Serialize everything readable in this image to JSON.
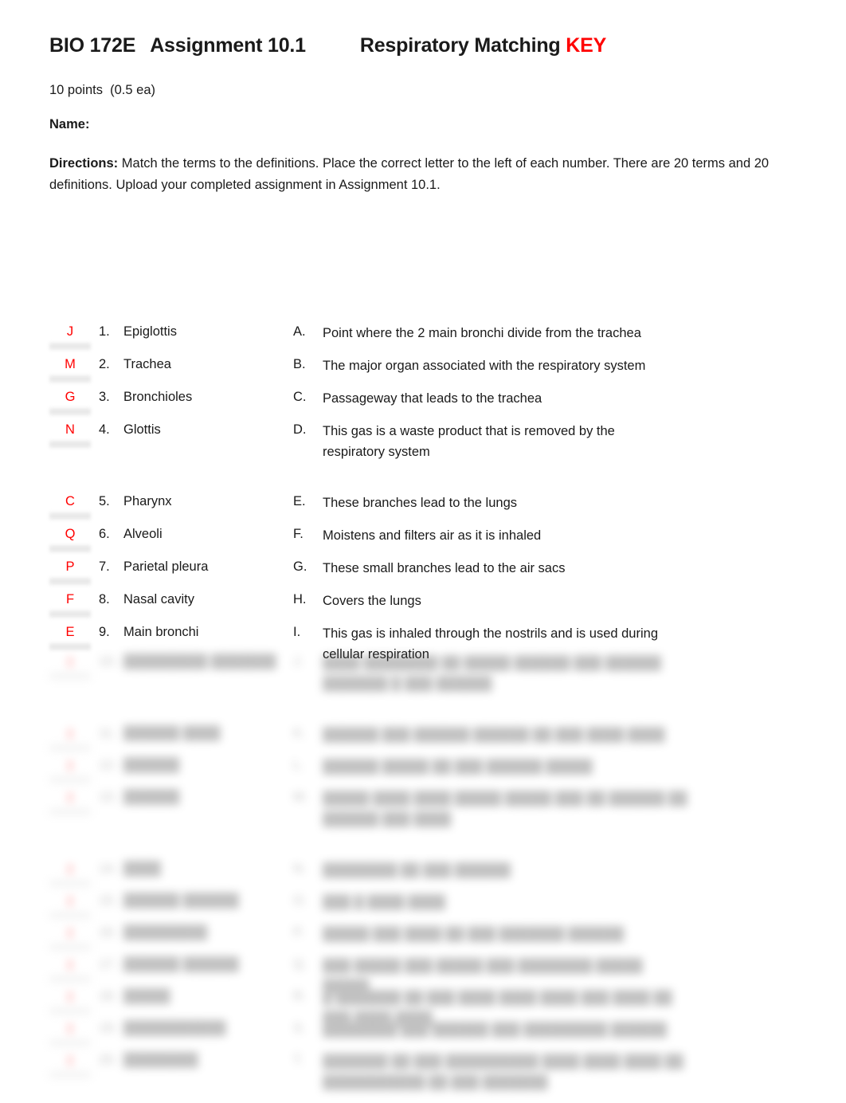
{
  "document": {
    "course": "BIO 172E",
    "assignment": "Assignment 10.1",
    "title": "Respiratory Matching",
    "key_flag": "KEY",
    "points": "10 points  (0.5 ea)",
    "name_label": "Name:",
    "directions_label": "Directions:",
    "directions_text": " Match the terms to the definitions. Place the correct letter to the left of each number. There are 20 terms and 20 definitions.  Upload your completed assignment in Assignment 10.1."
  },
  "colors": {
    "key_red": "#ff0000",
    "answer_red": "#ff0000",
    "body_text": "#1a1a1a",
    "blank_gray": "#e8e8e8",
    "page_background": "#ffffff"
  },
  "visible_terms": [
    {
      "answer": "J",
      "number": "1.",
      "term": "Epiglottis"
    },
    {
      "answer": "M",
      "number": "2.",
      "term": "Trachea"
    },
    {
      "answer": "G",
      "number": "3.",
      "term": "Bronchioles"
    },
    {
      "answer": "N",
      "number": "4.",
      "term": "Glottis"
    },
    {
      "answer": "C",
      "number": "5.",
      "term": "Pharynx"
    },
    {
      "answer": "Q",
      "number": "6.",
      "term": "Alveoli"
    },
    {
      "answer": "P",
      "number": "7.",
      "term": "Parietal pleura"
    },
    {
      "answer": "F",
      "number": "8.",
      "term": "Nasal cavity"
    },
    {
      "answer": "E",
      "number": "9.",
      "term": "Main bronchi"
    }
  ],
  "visible_definitions": [
    {
      "letter": "A.",
      "text": "Point where the 2 main bronchi divide from the trachea"
    },
    {
      "letter": "B.",
      "text": "The major organ associated with the respiratory system"
    },
    {
      "letter": "C.",
      "text": "Passageway that leads to the trachea"
    },
    {
      "letter": "D.",
      "text": "This gas is a waste product that is removed by the respiratory system"
    },
    {
      "letter": "E.",
      "text": "These branches lead to the lungs"
    },
    {
      "letter": "F.",
      "text": "Moistens and filters air as it is inhaled"
    },
    {
      "letter": "G.",
      "text": "These small branches lead to the air sacs"
    },
    {
      "letter": "H.",
      "text": "Covers the lungs"
    },
    {
      "letter": "I.",
      "text": "This gas is inhaled through the nostrils and is used during cellular respiration"
    }
  ],
  "obscured_terms": [
    {
      "answer": "▮",
      "number": "10.",
      "term": "█████████ ███████"
    },
    {
      "answer": "▮",
      "number": "11.",
      "term": "██████ ████"
    },
    {
      "answer": "▮",
      "number": "12.",
      "term": "██████"
    },
    {
      "answer": "▮",
      "number": "13.",
      "term": "██████"
    },
    {
      "answer": "▮",
      "number": "14.",
      "term": "████"
    },
    {
      "answer": "▮",
      "number": "15.",
      "term": "██████ ██████"
    },
    {
      "answer": "▮",
      "number": "16.",
      "term": "█████████"
    },
    {
      "answer": "▮",
      "number": "17.",
      "term": "██████ ██████"
    },
    {
      "answer": "▮",
      "number": "18.",
      "term": "█████"
    },
    {
      "answer": "▮",
      "number": "19.",
      "term": "███████████"
    },
    {
      "answer": "▮",
      "number": "20.",
      "term": "████████"
    }
  ],
  "obscured_definitions": [
    {
      "letter": "J.",
      "text": "████ ████████ ██ █████ ██████ ███ ██████ ███████ █ ███ ██████"
    },
    {
      "letter": "K.",
      "text": "██████ ███ ██████ ██████ ██ ███ ████ ████"
    },
    {
      "letter": "L.",
      "text": "██████ █████ ██ ███ ██████ █████"
    },
    {
      "letter": "M.",
      "text": "█████ ████ ████ █████ █████ ███ ██ ██████ ██ ██████ ███ ████"
    },
    {
      "letter": "N.",
      "text": "████████ ██ ███ ██████"
    },
    {
      "letter": "O.",
      "text": "███ █ ████ ████"
    },
    {
      "letter": "P.",
      "text": "█████ ███ ████ ██ ███ ███████ ██████"
    },
    {
      "letter": "Q.",
      "text": "███ █████ ███ █████ ███ ████████ █████ █████"
    },
    {
      "letter": "R.",
      "text": "█ ███████ ██ ███ ████ ████ ████ ███ ████ ██ ███ ████ ████"
    },
    {
      "letter": "S.",
      "text": "████████ ███ ██████ ███ █████████ ██████"
    },
    {
      "letter": "T.",
      "text": "███████ ██ ███ ██████████ ████ ████ ████ ██ ███████████ ██ ███ ███████"
    }
  ]
}
